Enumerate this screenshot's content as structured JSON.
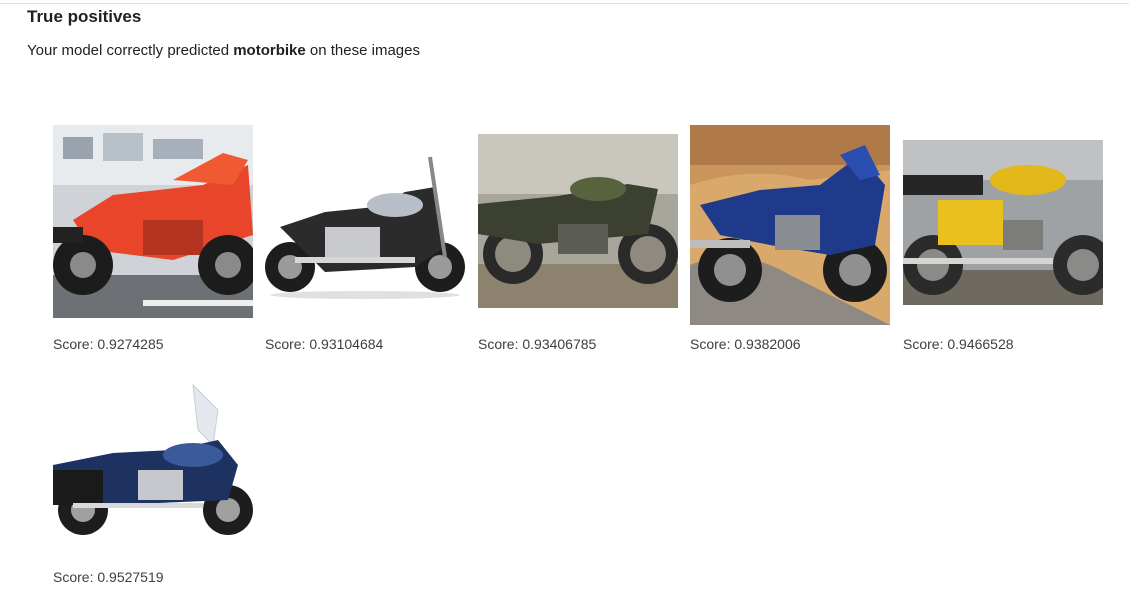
{
  "section": {
    "title": "True positives",
    "subtitle_prefix": "Your model correctly predicted",
    "label": "motorbike",
    "subtitle_suffix": "on these images"
  },
  "score_prefix": "Score:",
  "items": [
    {
      "score": "0.9274285",
      "image": "red racing motorbike on display stand"
    },
    {
      "score": "0.93104684",
      "image": "black and chrome cruiser motorbike"
    },
    {
      "score": "0.93406785",
      "image": "old green motorbike against wall"
    },
    {
      "score": "0.9382006",
      "image": "blue sport touring motorbike on road"
    },
    {
      "score": "0.9466528",
      "image": "yellow vintage motorbike"
    },
    {
      "score": "0.9527519",
      "image": "blue touring motorbike with windshield"
    }
  ]
}
